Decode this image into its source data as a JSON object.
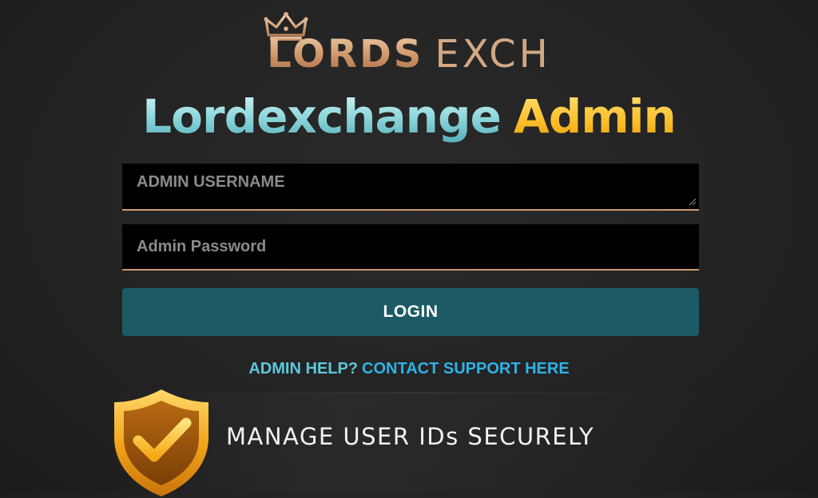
{
  "brand": {
    "logo_part1": "LORDS",
    "logo_part2": "EXCH",
    "logo_icon": "crown-icon"
  },
  "title": {
    "main": "Lordexchange",
    "accent": "Admin"
  },
  "form": {
    "username_placeholder": "ADMIN USERNAME",
    "password_placeholder": "Admin Password",
    "login_label": "LOGIN"
  },
  "help": {
    "prefix": "ADMIN HELP?",
    "link": "CONTACT SUPPORT HERE"
  },
  "feature": {
    "icon": "shield-check-icon",
    "text": "MANAGE USER IDs SECURELY"
  },
  "colors": {
    "background": "#242424",
    "field_background": "#000000",
    "field_underline": "#c89a72",
    "login_button": "#1c5b66",
    "title_main": "#8fd3d8",
    "title_accent": "#f6b91d",
    "help_prefix": "#5cc8da",
    "help_link": "#2fb2e6",
    "brand": "#d2a886"
  }
}
